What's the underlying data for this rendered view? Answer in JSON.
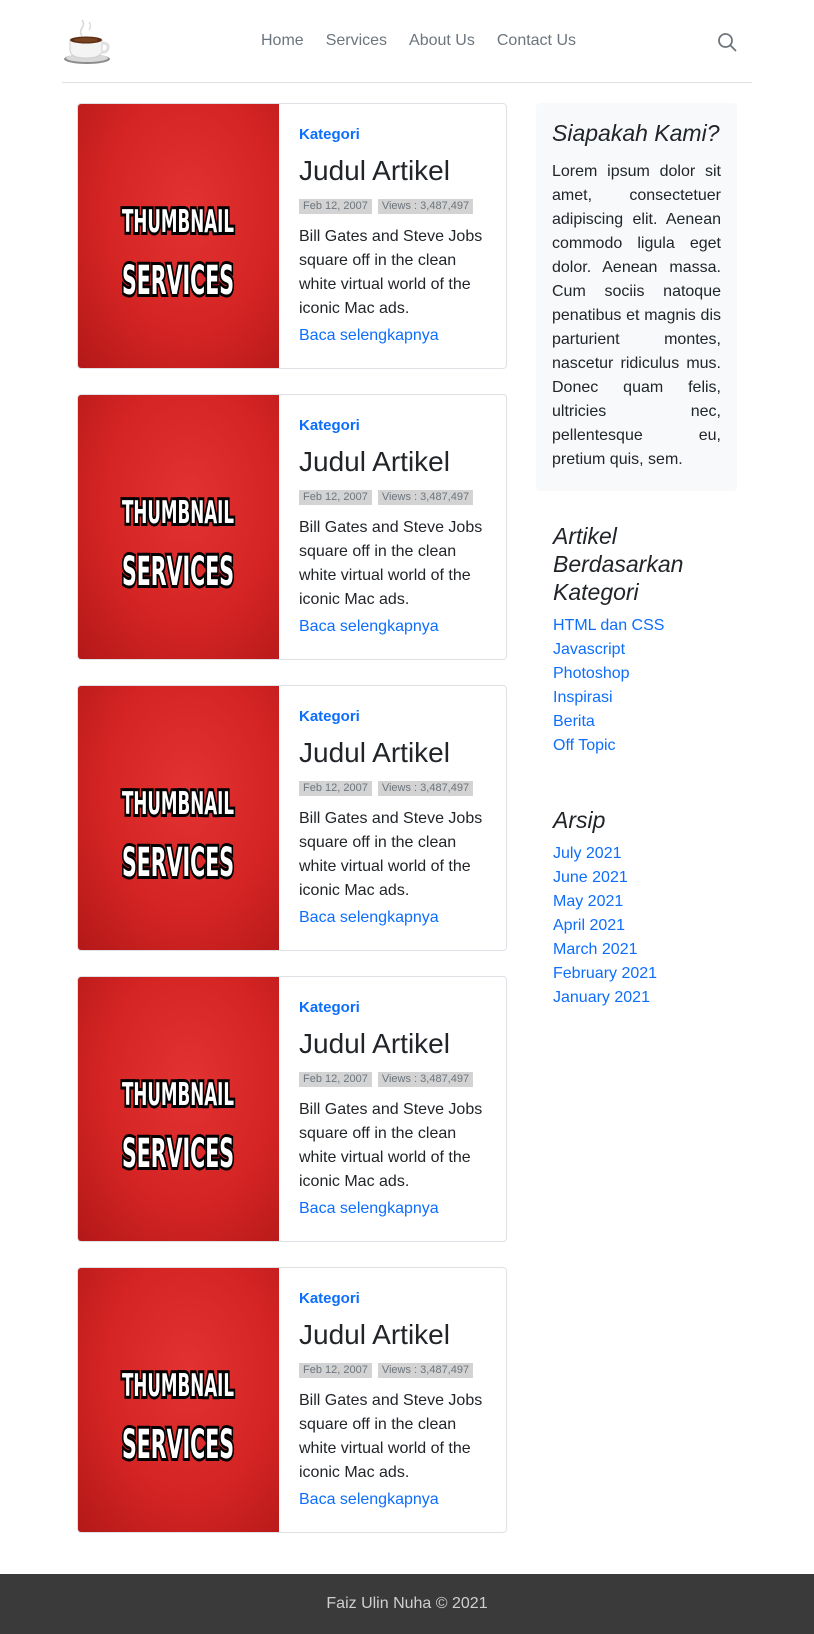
{
  "nav": {
    "items": [
      "Home",
      "Services",
      "About Us",
      "Contact Us"
    ]
  },
  "icons": {
    "logo": "coffee-cup-icon",
    "search": "search-icon"
  },
  "colors": {
    "accent": "#0d6efd",
    "thumbnail_bg": "#d42424",
    "footer_bg": "#3a3a3a",
    "sidebar_bg": "#f8f9fa"
  },
  "articles": [
    {
      "thumbnail_text": [
        "THUMBNAIL",
        "SERVICES"
      ],
      "category": "Kategori",
      "title": "Judul Artikel",
      "date": "Feb 12, 2007",
      "views": "Views : 3,487,497",
      "excerpt": "Bill Gates and Steve Jobs square off in the clean white virtual world of the iconic Mac ads.",
      "read_more": "Baca selengkapnya"
    },
    {
      "thumbnail_text": [
        "THUMBNAIL",
        "SERVICES"
      ],
      "category": "Kategori",
      "title": "Judul Artikel",
      "date": "Feb 12, 2007",
      "views": "Views : 3,487,497",
      "excerpt": "Bill Gates and Steve Jobs square off in the clean white virtual world of the iconic Mac ads.",
      "read_more": "Baca selengkapnya"
    },
    {
      "thumbnail_text": [
        "THUMBNAIL",
        "SERVICES"
      ],
      "category": "Kategori",
      "title": "Judul Artikel",
      "date": "Feb 12, 2007",
      "views": "Views : 3,487,497",
      "excerpt": "Bill Gates and Steve Jobs square off in the clean white virtual world of the iconic Mac ads.",
      "read_more": "Baca selengkapnya"
    },
    {
      "thumbnail_text": [
        "THUMBNAIL",
        "SERVICES"
      ],
      "category": "Kategori",
      "title": "Judul Artikel",
      "date": "Feb 12, 2007",
      "views": "Views : 3,487,497",
      "excerpt": "Bill Gates and Steve Jobs square off in the clean white virtual world of the iconic Mac ads.",
      "read_more": "Baca selengkapnya"
    },
    {
      "thumbnail_text": [
        "THUMBNAIL",
        "SERVICES"
      ],
      "category": "Kategori",
      "title": "Judul Artikel",
      "date": "Feb 12, 2007",
      "views": "Views : 3,487,497",
      "excerpt": "Bill Gates and Steve Jobs square off in the clean white virtual world of the iconic Mac ads.",
      "read_more": "Baca selengkapnya"
    }
  ],
  "sidebar": {
    "about": {
      "title": "Siapakah Kami?",
      "text": "Lorem ipsum dolor sit amet, consectetuer adipiscing elit. Aenean commodo ligula eget dolor. Aenean massa. Cum sociis natoque penatibus et magnis dis parturient montes, nascetur ridiculus mus. Donec quam felis, ultricies nec, pellentesque eu, pretium quis, sem."
    },
    "categories": {
      "title": "Artikel Berdasarkan Kategori",
      "items": [
        "HTML dan CSS",
        "Javascript",
        "Photoshop",
        "Inspirasi",
        "Berita",
        "Off Topic"
      ]
    },
    "archive": {
      "title": "Arsip",
      "items": [
        "July 2021",
        "June 2021",
        "May 2021",
        "April 2021",
        "March 2021",
        "February 2021",
        "January 2021"
      ]
    }
  },
  "footer": {
    "text": "Faiz Ulin Nuha © 2021"
  }
}
